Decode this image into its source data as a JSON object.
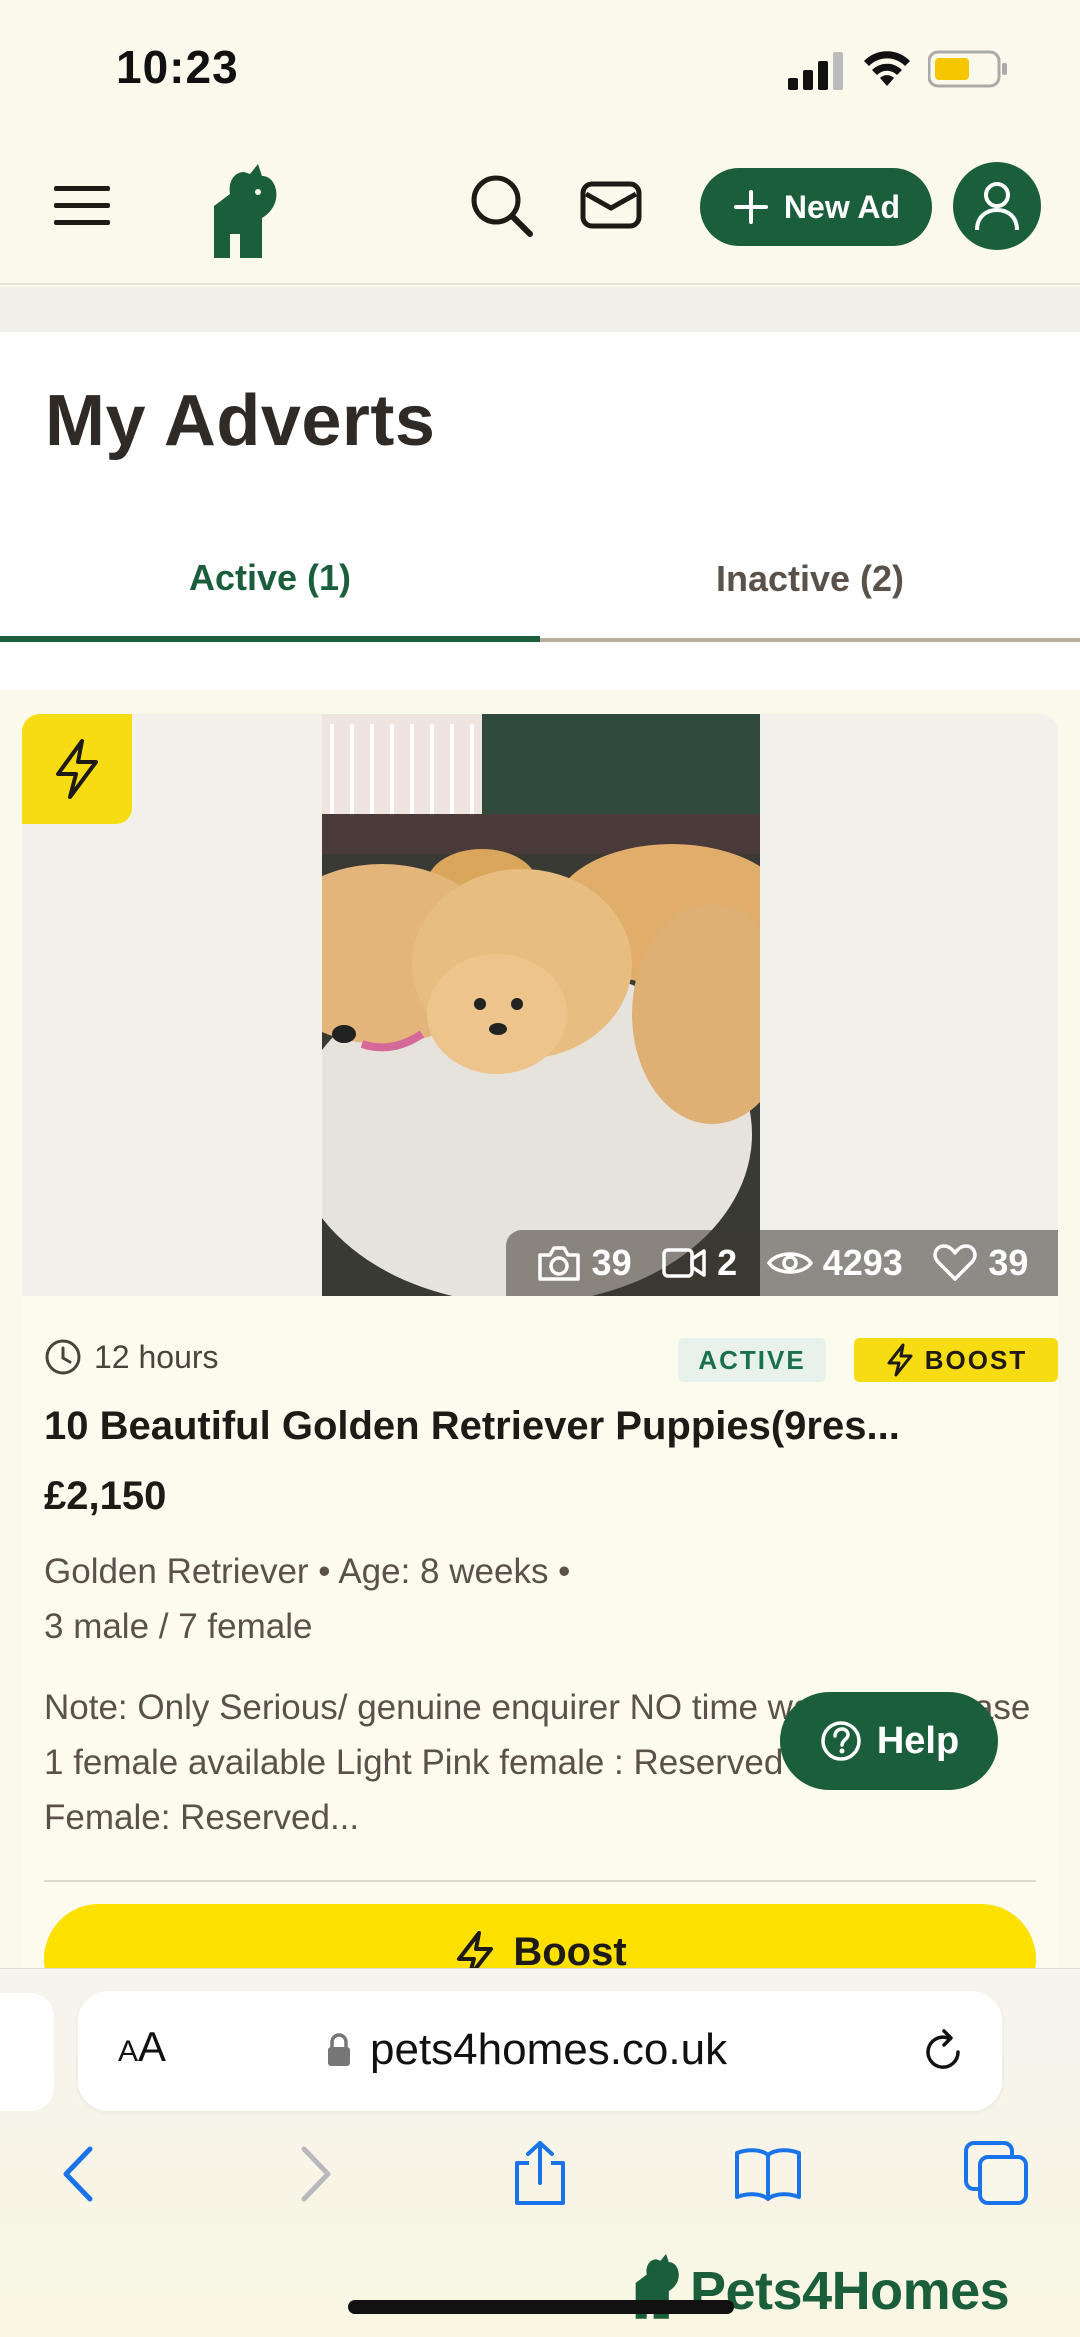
{
  "status_bar": {
    "time": "10:23"
  },
  "header": {
    "new_ad_label": "New Ad"
  },
  "page": {
    "title": "My Adverts",
    "tabs": [
      {
        "label": "Active (1)",
        "active": true
      },
      {
        "label": "Inactive (2)",
        "active": false
      }
    ]
  },
  "listing": {
    "stats": {
      "photos": "39",
      "videos": "2",
      "views": "4293",
      "favourites": "39"
    },
    "time_ago": "12 hours",
    "status_badge": "ACTIVE",
    "boost_badge": "BOOST",
    "title": "10 Beautiful Golden Retriever Puppies(9res...",
    "price": "£2,150",
    "details_line1": "Golden Retriever • Age: 8 weeks •",
    "details_line2": "3 male / 7 female",
    "note": "Note: Only Serious/ genuine enquirer NO time wasters!!! please 1 female available Light Pink female : Reserved Dark Pink Female: Reserved...",
    "boost_button_label": "Boost"
  },
  "help_label": "Help",
  "browser": {
    "url": "pets4homes.co.uk",
    "aa": "AA"
  },
  "watermark": "Pets4Homes",
  "colors": {
    "brand_green": "#1a5e3b",
    "boost_yellow": "#f7dc13",
    "background": "#FBF9EC"
  }
}
